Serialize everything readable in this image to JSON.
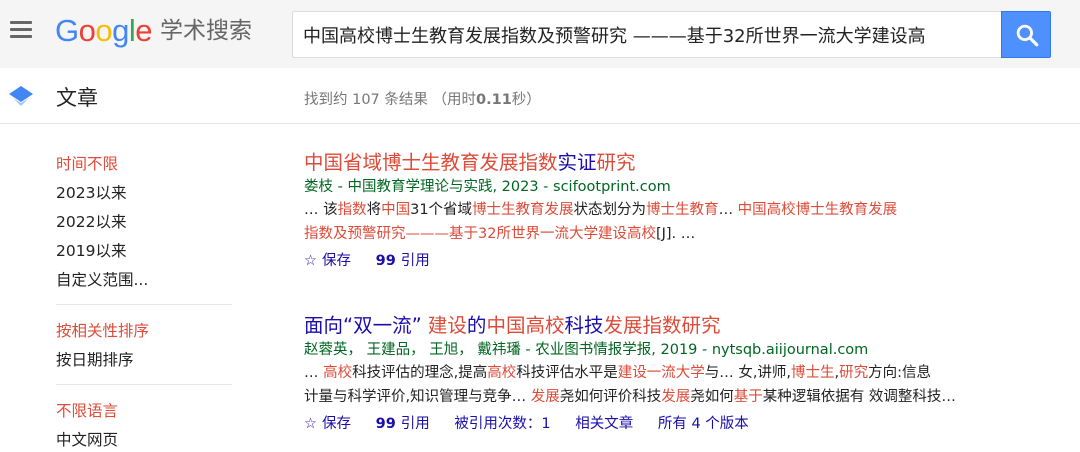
{
  "header": {
    "logo_parts": [
      "G",
      "o",
      "o",
      "g",
      "l",
      "e"
    ],
    "scholar_label": "学术搜索",
    "search_value": "中国高校博士生教育发展指数及预警研究 ———基于32所世界一流大学建设高",
    "search_button_icon": "search-icon",
    "menu_icon": "hamburger-menu-icon"
  },
  "subbar": {
    "section_icon": "scholar-cap-icon",
    "section_title": "文章",
    "stats_prefix": "找到约 107 条结果 （用时",
    "stats_time": "0.11",
    "stats_suffix": "秒）"
  },
  "sidebar": {
    "time_filters": [
      "时间不限",
      "2023以来",
      "2022以来",
      "2019以来",
      "自定义范围..."
    ],
    "sort_options": [
      "按相关性排序",
      "按日期排序"
    ],
    "language_filters": [
      "不限语言",
      "中文网页"
    ]
  },
  "results": [
    {
      "title_segments": [
        {
          "text": "中国省域",
          "hl": true
        },
        {
          "text": "博士生教育发展指数",
          "hl": true
        },
        {
          "text": "实证",
          "hl": false
        },
        {
          "text": "研究",
          "hl": true
        }
      ],
      "meta": "娄枝 - 中国教育学理论与实践, 2023 - scifootprint.com",
      "snippet_line1": [
        {
          "text": "… 该",
          "hl": false
        },
        {
          "text": "指数",
          "hl": true
        },
        {
          "text": "将",
          "hl": false
        },
        {
          "text": "中国",
          "hl": true
        },
        {
          "text": "31个省域",
          "hl": false
        },
        {
          "text": "博士生教育发展",
          "hl": true
        },
        {
          "text": "状态划分为",
          "hl": false
        },
        {
          "text": "博士生教育",
          "hl": true
        },
        {
          "text": "… ",
          "hl": false
        },
        {
          "text": "中国高校博士生教育发展",
          "hl": true
        }
      ],
      "snippet_line2": [
        {
          "text": "指数及预警研究———基于32所世界一流大学建设高校",
          "hl": true
        },
        {
          "text": "[J]. …",
          "hl": false
        }
      ],
      "links": {
        "save": "保存",
        "cite": "引用"
      }
    },
    {
      "title_segments": [
        {
          "text": "面向“双一流” ",
          "hl": false
        },
        {
          "text": "建设",
          "hl": true
        },
        {
          "text": "的",
          "hl": false
        },
        {
          "text": "中国高校",
          "hl": true
        },
        {
          "text": "科技",
          "hl": false
        },
        {
          "text": "发展指数研究",
          "hl": true
        }
      ],
      "meta": "赵蓉英， 王建品， 王旭， 戴祎璠 - 农业图书情报学报, 2019 - nytsqb.aiijournal.com",
      "snippet_line1": [
        {
          "text": "… ",
          "hl": false
        },
        {
          "text": "高校",
          "hl": true
        },
        {
          "text": "科技评估的理念,提高",
          "hl": false
        },
        {
          "text": "高校",
          "hl": true
        },
        {
          "text": "科技评估水平是",
          "hl": false
        },
        {
          "text": "建设一流大学",
          "hl": true
        },
        {
          "text": "与… 女,讲师,",
          "hl": false
        },
        {
          "text": "博士生",
          "hl": true
        },
        {
          "text": ",",
          "hl": false
        },
        {
          "text": "研究",
          "hl": true
        },
        {
          "text": "方向:信息",
          "hl": false
        }
      ],
      "snippet_line2": [
        {
          "text": "计量与科学评价,知识管理与竞争… ",
          "hl": false
        },
        {
          "text": "发展",
          "hl": true
        },
        {
          "text": "尧如何评价科技",
          "hl": false
        },
        {
          "text": "发展",
          "hl": true
        },
        {
          "text": "尧如何",
          "hl": false
        },
        {
          "text": "基于",
          "hl": true
        },
        {
          "text": "某种逻辑依据有 效调整科技…",
          "hl": false
        }
      ],
      "links": {
        "save": "保存",
        "cite": "引用",
        "cited_by": "被引用次数：1",
        "related": "相关文章",
        "versions": "所有 4 个版本"
      }
    }
  ],
  "colors": {
    "link": "#1a0dab",
    "highlight": "#dd4b39",
    "meta_green": "#006621",
    "search_button": "#4d90fe",
    "header_bg": "#f5f5f5"
  }
}
